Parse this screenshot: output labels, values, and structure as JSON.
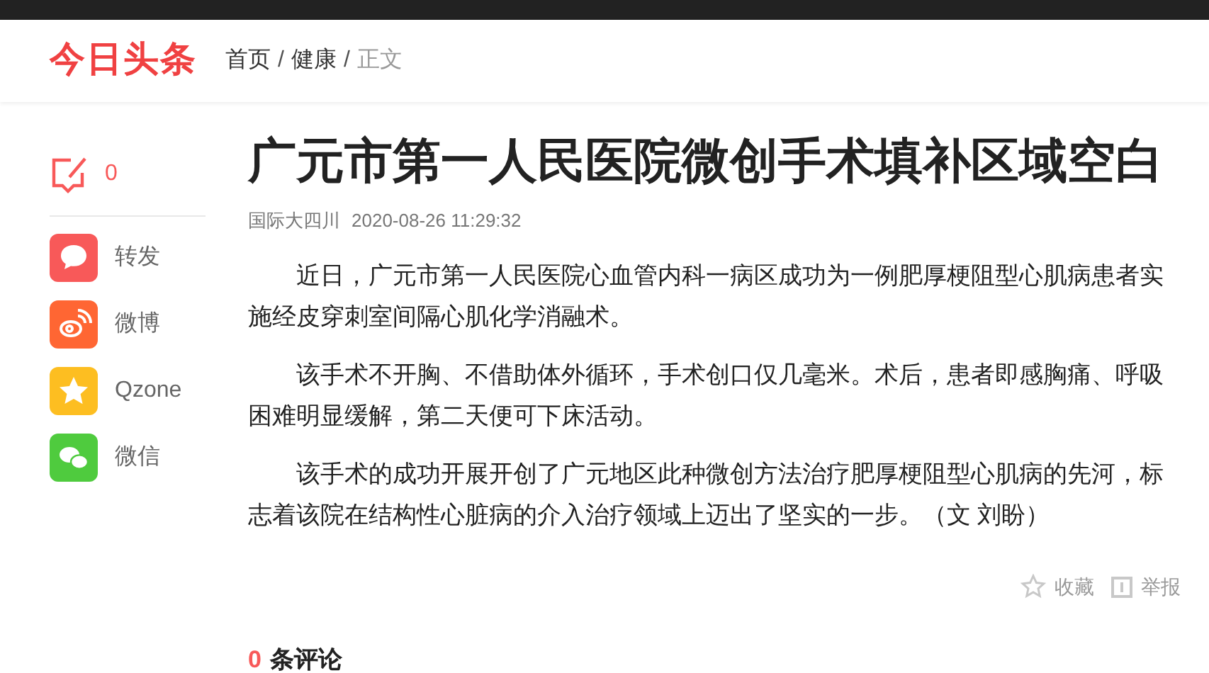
{
  "header": {
    "logo": "今日头条",
    "breadcrumb": [
      {
        "label": "首页",
        "current": false
      },
      {
        "label": "健康",
        "current": false
      },
      {
        "label": "正文",
        "current": true
      }
    ],
    "separator": "/"
  },
  "sidebar": {
    "comment_count": "0",
    "share": [
      {
        "kind": "bubble",
        "label": "转发",
        "color": "#f85959"
      },
      {
        "kind": "weibo",
        "label": "微博",
        "color": "#ff6633"
      },
      {
        "kind": "qzone",
        "label": "Qzone",
        "color": "#fdbe21"
      },
      {
        "kind": "wechat",
        "label": "微信",
        "color": "#4fcb3e"
      }
    ]
  },
  "article": {
    "title": "广元市第一人民医院微创手术填补区域空白",
    "source": "国际大四川",
    "time": "2020-08-26 11:29:32",
    "paragraphs": [
      "近日，广元市第一人民医院心血管内科一病区成功为一例肥厚梗阻型心肌病患者实施经皮穿刺室间隔心肌化学消融术。",
      "该手术不开胸、不借助体外循环，手术创口仅几毫米。术后，患者即感胸痛、呼吸困难明显缓解，第二天便可下床活动。",
      "该手术的成功开展开创了广元地区此种微创方法治疗肥厚梗阻型心肌病的先河，标志着该院在结构性心脏病的介入治疗领域上迈出了坚实的一步。（文 刘盼）"
    ],
    "actions": [
      {
        "kind": "favorite",
        "label": "收藏"
      },
      {
        "kind": "report",
        "label": "举报"
      }
    ]
  },
  "comments": {
    "count": "0",
    "label": "条评论"
  }
}
